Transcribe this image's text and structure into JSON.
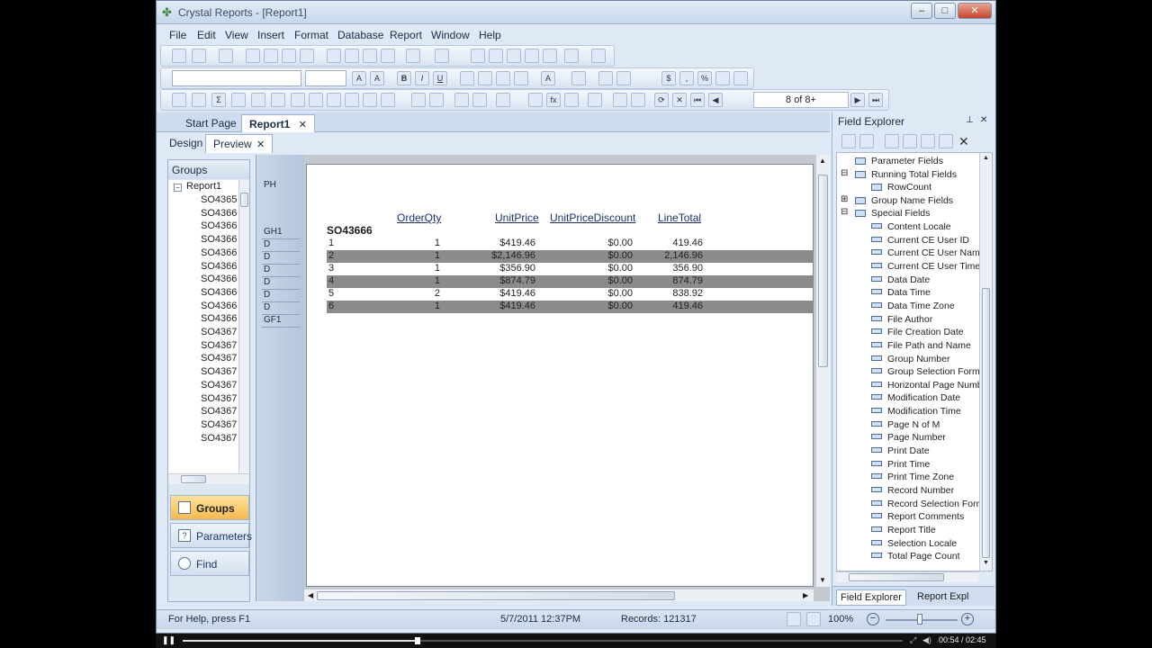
{
  "window": {
    "title": "Crystal Reports - [Report1]",
    "minimize": "–",
    "maximize": "□",
    "close": "✕"
  },
  "menu": [
    "File",
    "Edit",
    "View",
    "Insert",
    "Format",
    "Database",
    "Report",
    "Window",
    "Help"
  ],
  "nav": {
    "page_indicator": "8 of 8+"
  },
  "tabs": {
    "start_page": "Start Page",
    "report1": "Report1",
    "close": "✕"
  },
  "subtabs": {
    "design": "Design",
    "preview": "Preview",
    "close": "✕"
  },
  "groups_panel": {
    "title": "Groups",
    "root": "Report1",
    "items": [
      "SO4365",
      "SO4366",
      "SO4366",
      "SO4366",
      "SO4366",
      "SO4366",
      "SO4366",
      "SO4366",
      "SO4366",
      "SO4366",
      "SO4367",
      "SO4367",
      "SO4367",
      "SO4367",
      "SO4367",
      "SO4367",
      "SO4367",
      "SO4367",
      "SO4367"
    ],
    "nav_buttons": [
      "Groups",
      "Parameters",
      "Find"
    ]
  },
  "sections": [
    "PH",
    "GH1",
    "D",
    "D",
    "D",
    "D",
    "D",
    "D",
    "GF1"
  ],
  "report": {
    "headers": [
      "OrderQty",
      "UnitPrice",
      "UnitPriceDiscount",
      "LineTotal"
    ],
    "group_name": "SO43666",
    "rows": [
      [
        "1",
        "1",
        "$419.46",
        "$0.00",
        "419.46"
      ],
      [
        "2",
        "1",
        "$2,146.96",
        "$0.00",
        "2,146.96"
      ],
      [
        "3",
        "1",
        "$356.90",
        "$0.00",
        "356.90"
      ],
      [
        "4",
        "1",
        "$874.79",
        "$0.00",
        "874.79"
      ],
      [
        "5",
        "2",
        "$419.46",
        "$0.00",
        "838.92"
      ],
      [
        "6",
        "1",
        "$419.46",
        "$0.00",
        "419.46"
      ]
    ]
  },
  "field_explorer": {
    "title": "Field Explorer",
    "pin": "⊥",
    "close": "✕",
    "top_items": [
      {
        "label": "Parameter Fields",
        "expander": ""
      },
      {
        "label": "Running Total Fields",
        "expander": "⊟"
      },
      {
        "label": "RowCount",
        "expander": "",
        "child": true
      },
      {
        "label": "Group Name Fields",
        "expander": "⊞"
      },
      {
        "label": "Special Fields",
        "expander": "⊟"
      }
    ],
    "special_fields": [
      "Content Locale",
      "Current CE User ID",
      "Current CE User Name",
      "Current CE User Time",
      "Data Date",
      "Data Time",
      "Data Time Zone",
      "File Author",
      "File Creation Date",
      "File Path and Name",
      "Group Number",
      "Group Selection Formu",
      "Horizontal Page Numb",
      "Modification Date",
      "Modification Time",
      "Page N of M",
      "Page Number",
      "Print Date",
      "Print Time",
      "Print Time Zone",
      "Record Number",
      "Record Selection Form",
      "Report Comments",
      "Report Title",
      "Selection Locale",
      "Total Page Count"
    ],
    "bottom_tabs": [
      "Field Explorer",
      "Report Expl"
    ]
  },
  "status": {
    "help": "For Help, press F1",
    "datetime": "5/7/2011  12:37PM",
    "records": "Records:  121317",
    "zoom": "100%"
  },
  "player": {
    "time": "00:54 / 02:45"
  }
}
